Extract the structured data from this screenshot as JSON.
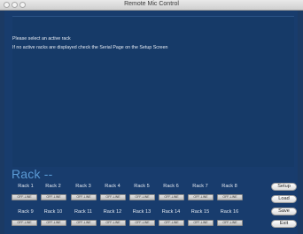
{
  "window": {
    "title": "Remote Mic Control"
  },
  "messages": {
    "line1": "Please select an active rack",
    "line2": "If no active racks are displayed check the Serial Page on the Setup Screen"
  },
  "rack_header": "Rack --",
  "racks_row1": [
    {
      "label": "Rack 1",
      "status": "OFF-LINE"
    },
    {
      "label": "Rack 2",
      "status": "OFF-LINE"
    },
    {
      "label": "Rack 3",
      "status": "OFF-LINE"
    },
    {
      "label": "Rack 4",
      "status": "OFF-LINE"
    },
    {
      "label": "Rack 5",
      "status": "OFF-LINE"
    },
    {
      "label": "Rack 6",
      "status": "OFF-LINE"
    },
    {
      "label": "Rack 7",
      "status": "OFF-LINE"
    },
    {
      "label": "Rack 8",
      "status": "OFF-LINE"
    }
  ],
  "racks_row2": [
    {
      "label": "Rack 9",
      "status": "OFF-LINE"
    },
    {
      "label": "Rack 10",
      "status": "OFF-LINE"
    },
    {
      "label": "Rack 11",
      "status": "OFF-LINE"
    },
    {
      "label": "Rack 12",
      "status": "OFF-LINE"
    },
    {
      "label": "Rack 13",
      "status": "OFF-LINE"
    },
    {
      "label": "Rack 14",
      "status": "OFF-LINE"
    },
    {
      "label": "Rack 15",
      "status": "OFF-LINE"
    },
    {
      "label": "Rack 16",
      "status": "OFF-LINE"
    }
  ],
  "side_buttons": {
    "setup": "Setup",
    "load": "Load",
    "save": "Save",
    "exit": "Exit"
  }
}
